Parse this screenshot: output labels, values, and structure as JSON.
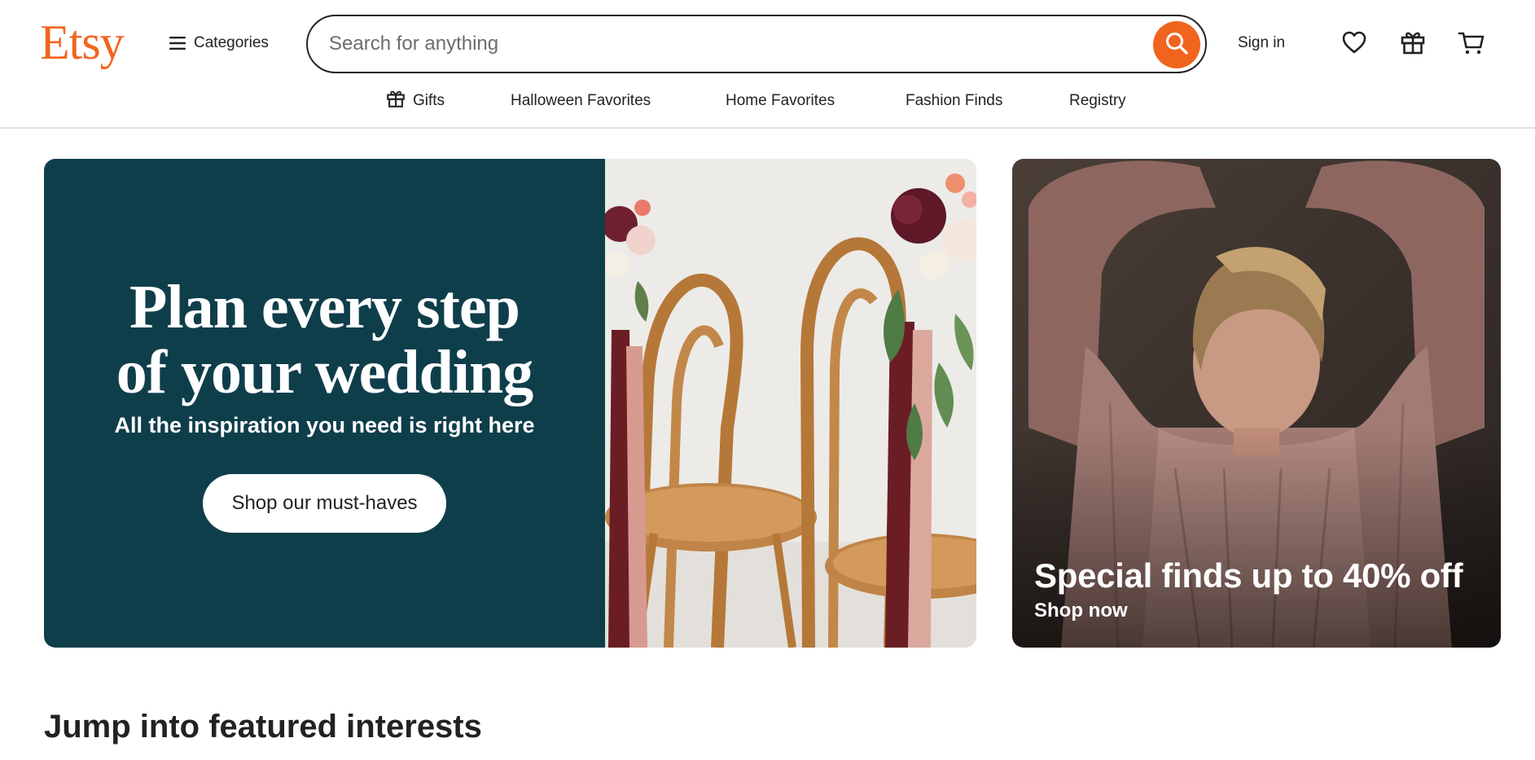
{
  "header": {
    "logo": "Etsy",
    "categories_label": "Categories",
    "search": {
      "placeholder": "Search for anything"
    },
    "signin_label": "Sign in",
    "icons": [
      "favorites-icon",
      "gift-icon",
      "cart-icon"
    ]
  },
  "subnav": {
    "items": [
      {
        "label": "Gifts",
        "icon": "gift-icon"
      },
      {
        "label": "Halloween Favorites"
      },
      {
        "label": "Home Favorites"
      },
      {
        "label": "Fashion Finds"
      },
      {
        "label": "Registry"
      }
    ]
  },
  "hero": {
    "title_line1": "Plan every step",
    "title_line2": "of your wedding",
    "subtitle": "All the inspiration you need is right here",
    "button_label": "Shop our must-haves"
  },
  "promo": {
    "title": "Special finds up to 40% off",
    "link_label": "Shop now"
  },
  "featured": {
    "title": "Jump into featured interests"
  },
  "colors": {
    "brand": "#f1641e",
    "hero_bg": "#0f3e4b",
    "text": "#222222"
  }
}
